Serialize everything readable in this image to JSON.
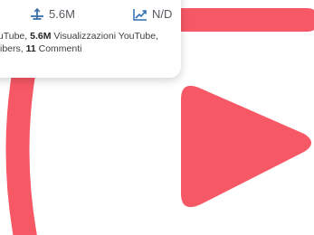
{
  "colors": {
    "accent": "#f75866",
    "card": "#ffffff",
    "text": "#3c4043",
    "muted": "#555a60"
  },
  "card": {
    "views_icon": "play-stack-icon",
    "views_value": "5.6M",
    "trend_icon": "trend-up-icon",
    "trend_value": "N/D",
    "line1": {
      "pre": "YouTube, ",
      "views_bold": "5.6M",
      "post": " Visualizzazioni YouTube,"
    },
    "line2": {
      "pre": "scribers, ",
      "comments_bold": "11",
      "post": " Commenti"
    }
  },
  "logo": {
    "icon": "play-button-logo-icon"
  }
}
